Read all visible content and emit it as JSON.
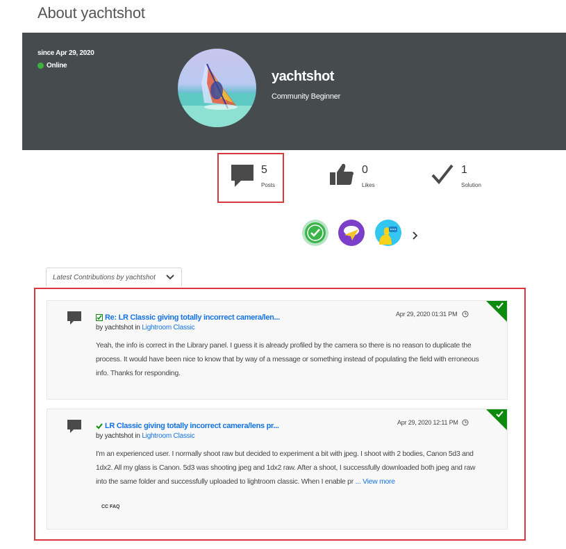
{
  "page": {
    "title": "About yachtshot"
  },
  "profile": {
    "since": "since Apr 29, 2020",
    "status": "Online",
    "username": "yachtshot",
    "rank": "Community Beginner"
  },
  "stats": {
    "posts": {
      "value": "5",
      "label": "Posts",
      "icon": "speech-bubble-icon"
    },
    "likes": {
      "value": "0",
      "label": "Likes",
      "icon": "thumbs-up-icon"
    },
    "solutions": {
      "value": "1",
      "label": "Solution",
      "icon": "checkmark-icon"
    }
  },
  "badges": [
    "check-badge-icon",
    "paper-plane-badge-icon",
    "chat-person-badge-icon"
  ],
  "contributions": {
    "filter_label": "Latest Contributions by yachtshot",
    "posts": [
      {
        "title": "Re: LR Classic giving totally incorrect camera/len...",
        "by_prefix": "by yachtshot in",
        "board": "Lightroom Classic",
        "date": "Apr 29, 2020 01:31 PM",
        "body": "Yeah, the info is correct in the Library panel. I guess it is already profiled by the camera so there is no reason to duplicate the process. It would have been nice to know that by way of a message or something instead of populating the field with erroneous info. Thanks for responding.",
        "solution_icon": "solution-check-icon"
      },
      {
        "title": "LR Classic giving totally incorrect camera/lens pr...",
        "by_prefix": "by yachtshot in",
        "board": "Lightroom Classic",
        "date": "Apr 29, 2020 12:11 PM",
        "body": "I'm an experienced user. I normally shoot raw but decided to experiment a bit with jpeg. I shoot with 2 bodies, Canon 5d3 and 1dx2. All my glass is Canon. 5d3 was shooting jpeg and 1dx2 raw. After a shoot, I successfully downloaded both jpeg and raw into the same folder and successfully uploaded to lightroom classic. When I enable pr",
        "more": "... View more",
        "tag": "CC FAQ",
        "solution_icon": "solved-check-icon"
      }
    ]
  },
  "colors": {
    "banner": "#464b4e",
    "link": "#1473e6",
    "accent_green": "#0d8a0d",
    "highlight_red": "#d9363e"
  }
}
